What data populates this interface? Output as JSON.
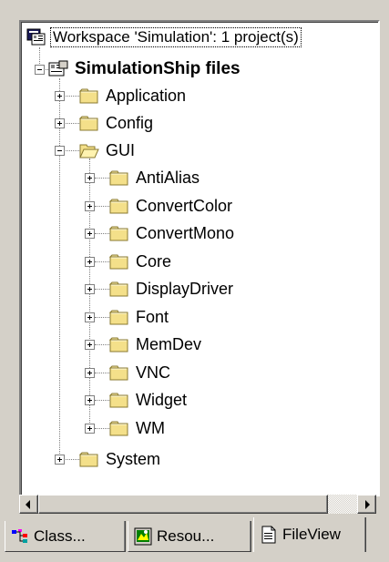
{
  "workspace": {
    "label": "Workspace 'Simulation': 1 project(s)"
  },
  "project": {
    "label": "SimulationShip files"
  },
  "folders": {
    "application": "Application",
    "config": "Config",
    "gui": "GUI",
    "system": "System"
  },
  "gui_children": [
    "AntiAlias",
    "ConvertColor",
    "ConvertMono",
    "Core",
    "DisplayDriver",
    "Font",
    "MemDev",
    "VNC",
    "Widget",
    "WM"
  ],
  "tabs": [
    {
      "label": "Class...",
      "icon": "class-view-icon"
    },
    {
      "label": "Resou...",
      "icon": "resource-view-icon"
    },
    {
      "label": "FileView",
      "icon": "file-view-icon"
    }
  ],
  "colors": {
    "folder": "#f4e08a",
    "folder_edge": "#8a7a30",
    "face": "#d4d0c8"
  }
}
